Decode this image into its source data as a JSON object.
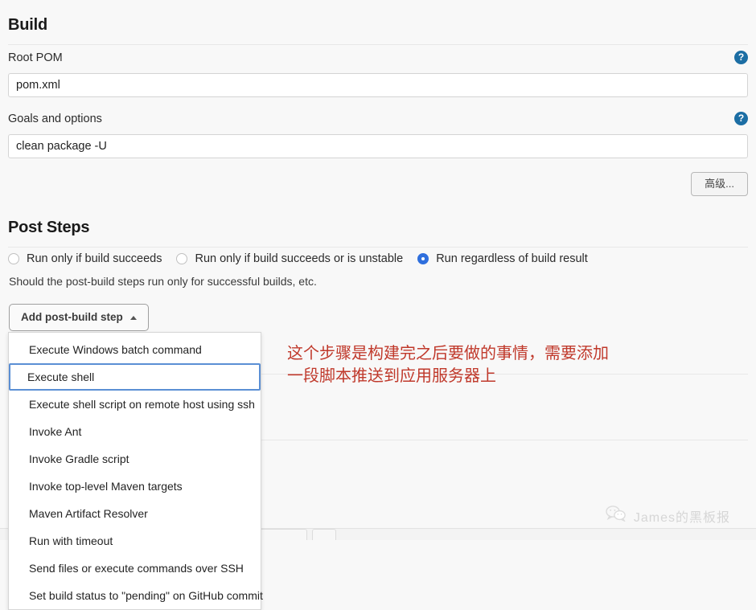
{
  "build_section": {
    "title": "Build",
    "fields": [
      {
        "label": "Root POM",
        "value": "pom.xml",
        "help_icon": "help-circle-icon"
      },
      {
        "label": "Goals and options",
        "value": "clean package -U",
        "help_icon": "help-circle-icon"
      }
    ],
    "advanced_button": "高级..."
  },
  "post_steps_section": {
    "title": "Post Steps",
    "radios": [
      {
        "label": "Run only if build succeeds",
        "checked": false
      },
      {
        "label": "Run only if build succeeds or is unstable",
        "checked": false
      },
      {
        "label": "Run regardless of build result",
        "checked": true
      }
    ],
    "hint": "Should the post-build steps run only for successful builds, etc.",
    "add_step_button": {
      "label": "Add post-build step",
      "caret_icon": "caret-up-icon"
    },
    "menu_items": [
      {
        "label": "Execute Windows batch command",
        "selected": false
      },
      {
        "label": "Execute shell",
        "selected": true
      },
      {
        "label": "Execute shell script on remote host using ssh",
        "selected": false
      },
      {
        "label": "Invoke Ant",
        "selected": false
      },
      {
        "label": "Invoke Gradle script",
        "selected": false
      },
      {
        "label": "Invoke top-level Maven targets",
        "selected": false
      },
      {
        "label": "Maven Artifact Resolver",
        "selected": false
      },
      {
        "label": "Run with timeout",
        "selected": false
      },
      {
        "label": "Send files or execute commands over SSH",
        "selected": false
      },
      {
        "label": "Set build status to \"pending\" on GitHub commit",
        "selected": false
      }
    ]
  },
  "annotation": {
    "text": "这个步骤是构建完之后要做的事情，需要添加\n一段脚本推送到应用服务器上",
    "color": "#c0392b"
  },
  "watermark": {
    "icon": "wechat-icon",
    "label": "James的黑板报"
  },
  "colors": {
    "accent_blue": "#1c6ea4",
    "radio_selected": "#2f6fdd",
    "menu_highlight": "#5b8fd4",
    "page_background": "#f8f8f8"
  }
}
